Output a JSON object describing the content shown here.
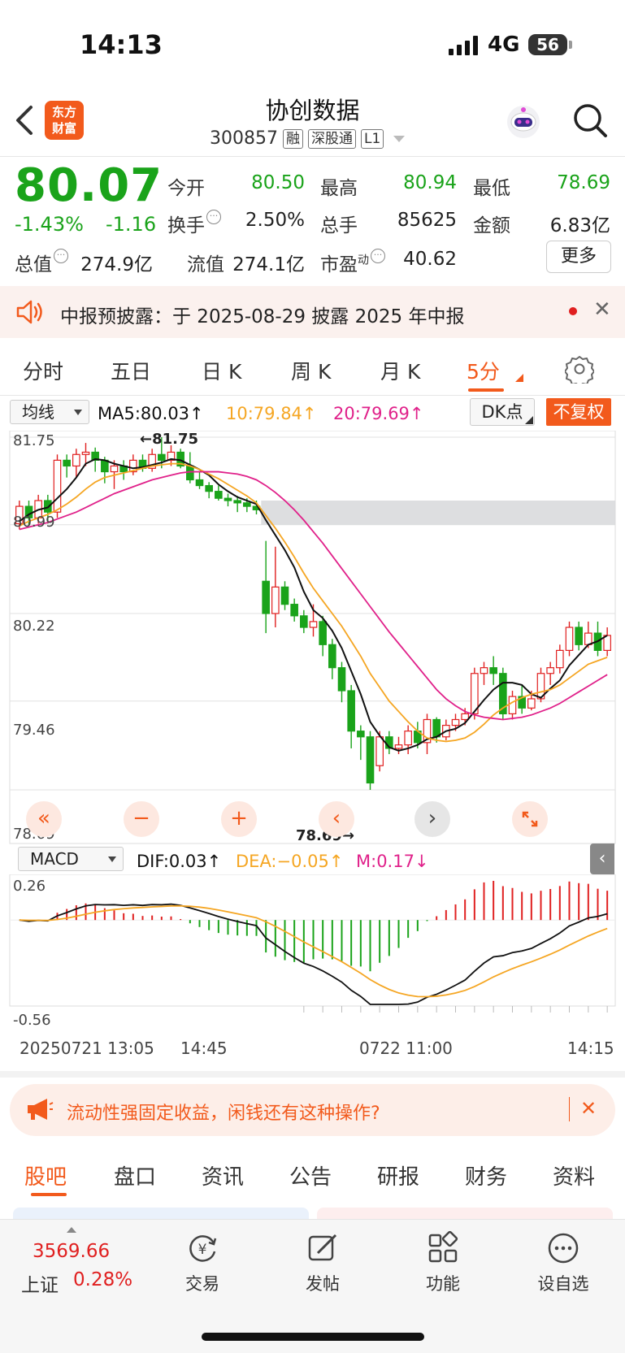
{
  "status": {
    "time": "14:13",
    "network": "4G",
    "battery": "56"
  },
  "header": {
    "logo_line1": "东方",
    "logo_line2": "财富",
    "title": "协创数据",
    "code": "300857",
    "tags": [
      "融",
      "深股通",
      "L1"
    ]
  },
  "quote": {
    "price": "80.07",
    "change_pct": "-1.43%",
    "change": "-1.16",
    "fields": {
      "open_label": "今开",
      "open": "80.50",
      "high_label": "最高",
      "high": "80.94",
      "low_label": "最低",
      "low": "78.69",
      "turnover_label": "换手",
      "turnover": "2.50%",
      "volume_label": "总手",
      "volume": "85625",
      "amount_label": "金额",
      "amount": "6.83亿",
      "mktcap_label": "总值",
      "mktcap": "274.9亿",
      "float_label": "流值",
      "float": "274.1亿",
      "pe_label": "市盈",
      "pe_sup": "动",
      "pe": "40.62"
    },
    "more_label": "更多"
  },
  "notice": {
    "text": "中报预披露：于 2025-08-29 披露 2025 年中报"
  },
  "period_tabs": [
    "分时",
    "五日",
    "日 K",
    "周 K",
    "月 K",
    "5分"
  ],
  "active_period": "5分",
  "indicator_row": {
    "main_select": "均线",
    "ma5": "MA5:80.03↑",
    "ma10": "10:79.84↑",
    "ma20": "20:79.69↑",
    "dk_label": "DK点",
    "fq_label": "不复权"
  },
  "colors": {
    "accent": "#f25a1c",
    "up": "#e02020",
    "down": "#1aa31a",
    "ma5": "#111111",
    "ma10": "#f5a623",
    "ma20": "#e0218a"
  },
  "price_axis": [
    "81.75",
    "80.99",
    "80.22",
    "79.46",
    "78.69"
  ],
  "markers": {
    "high": "←81.75",
    "low": "78.69→"
  },
  "macd": {
    "select": "MACD",
    "dif": "DIF:0.03↑",
    "dea": "DEA:−0.05↑",
    "m": "M:0.17↓",
    "axis_top": "0.26",
    "axis_bottom": "-0.56"
  },
  "time_axis": [
    "20250721 13:05",
    "14:45",
    "0722 11:00",
    "14:15"
  ],
  "chart_data": {
    "type": "candlestick",
    "interval": "5min",
    "ylim": [
      78.69,
      81.75
    ],
    "y_ticks": [
      81.75,
      80.99,
      80.22,
      79.46,
      78.69
    ],
    "high": 81.75,
    "low": 78.69,
    "candles": [
      [
        81.0,
        81.15,
        80.95,
        81.2
      ],
      [
        81.15,
        81.05,
        80.98,
        81.2
      ],
      [
        81.05,
        81.2,
        81.0,
        81.25
      ],
      [
        81.2,
        81.1,
        81.0,
        81.25
      ],
      [
        81.1,
        81.55,
        81.05,
        81.6
      ],
      [
        81.55,
        81.5,
        81.4,
        81.6
      ],
      [
        81.5,
        81.6,
        81.4,
        81.65
      ],
      [
        81.6,
        81.62,
        81.5,
        81.7
      ],
      [
        81.62,
        81.55,
        81.45,
        81.66
      ],
      [
        81.55,
        81.45,
        81.35,
        81.58
      ],
      [
        81.45,
        81.5,
        81.3,
        81.55
      ],
      [
        81.5,
        81.45,
        81.38,
        81.55
      ],
      [
        81.45,
        81.55,
        81.42,
        81.6
      ],
      [
        81.55,
        81.48,
        81.45,
        81.6
      ],
      [
        81.48,
        81.6,
        81.45,
        81.65
      ],
      [
        81.6,
        81.55,
        81.48,
        81.75
      ],
      [
        81.55,
        81.62,
        81.5,
        81.68
      ],
      [
        81.62,
        81.5,
        81.48,
        81.65
      ],
      [
        81.5,
        81.38,
        81.35,
        81.62
      ],
      [
        81.38,
        81.33,
        81.3,
        81.45
      ],
      [
        81.33,
        81.28,
        81.22,
        81.36
      ],
      [
        81.28,
        81.22,
        81.2,
        81.33
      ],
      [
        81.22,
        81.2,
        81.15,
        81.26
      ],
      [
        81.2,
        81.18,
        81.1,
        81.24
      ],
      [
        81.18,
        81.15,
        81.1,
        81.22
      ],
      [
        81.15,
        81.12,
        81.08,
        81.2
      ],
      [
        80.5,
        80.22,
        80.05,
        80.85
      ],
      [
        80.22,
        80.45,
        80.1,
        80.8
      ],
      [
        80.45,
        80.3,
        80.25,
        80.5
      ],
      [
        80.3,
        80.2,
        80.15,
        80.35
      ],
      [
        80.2,
        80.1,
        80.05,
        80.25
      ],
      [
        80.1,
        80.15,
        80.02,
        80.3
      ],
      [
        80.15,
        79.95,
        79.85,
        80.2
      ],
      [
        79.95,
        79.75,
        79.65,
        80.0
      ],
      [
        79.75,
        79.55,
        79.45,
        79.8
      ],
      [
        79.55,
        79.2,
        79.05,
        79.6
      ],
      [
        79.2,
        79.15,
        78.95,
        79.25
      ],
      [
        79.15,
        78.75,
        78.69,
        79.2
      ],
      [
        78.9,
        79.15,
        78.85,
        79.2
      ],
      [
        79.15,
        79.05,
        79.0,
        79.2
      ],
      [
        79.05,
        79.08,
        79.0,
        79.15
      ],
      [
        79.08,
        79.2,
        79.0,
        79.25
      ],
      [
        79.2,
        79.1,
        79.05,
        79.28
      ],
      [
        79.1,
        79.3,
        79.0,
        79.35
      ],
      [
        79.3,
        79.15,
        79.1,
        79.32
      ],
      [
        79.15,
        79.25,
        79.12,
        79.3
      ],
      [
        79.25,
        79.3,
        79.2,
        79.35
      ],
      [
        79.3,
        79.35,
        79.25,
        79.4
      ],
      [
        79.35,
        79.7,
        79.3,
        79.75
      ],
      [
        79.7,
        79.75,
        79.6,
        79.8
      ],
      [
        79.75,
        79.7,
        79.6,
        79.85
      ],
      [
        79.7,
        79.35,
        79.3,
        79.75
      ],
      [
        79.35,
        79.5,
        79.3,
        79.55
      ],
      [
        79.5,
        79.4,
        79.35,
        79.6
      ],
      [
        79.4,
        79.48,
        79.38,
        79.55
      ],
      [
        79.48,
        79.7,
        79.45,
        79.75
      ],
      [
        79.7,
        79.75,
        79.6,
        79.8
      ],
      [
        79.75,
        79.9,
        79.7,
        79.95
      ],
      [
        79.9,
        80.1,
        79.85,
        80.15
      ],
      [
        80.1,
        79.95,
        79.9,
        80.15
      ],
      [
        79.95,
        80.05,
        79.92,
        80.15
      ],
      [
        80.05,
        79.9,
        79.85,
        80.15
      ],
      [
        79.9,
        80.03,
        79.85,
        80.1
      ]
    ],
    "series": [
      {
        "name": "MA5",
        "values": [
          81.02,
          81.08,
          81.12,
          81.14,
          81.22,
          81.3,
          81.4,
          81.52,
          81.56,
          81.55,
          81.52,
          81.5,
          81.48,
          81.49,
          81.51,
          81.53,
          81.56,
          81.55,
          81.51,
          81.47,
          81.42,
          81.34,
          81.28,
          81.23,
          81.2,
          81.17,
          81.03,
          80.9,
          80.77,
          80.62,
          80.41,
          80.25,
          80.18,
          80.07,
          79.92,
          79.72,
          79.52,
          79.28,
          79.16,
          79.06,
          79.03,
          79.05,
          79.08,
          79.13,
          79.15,
          79.2,
          79.22,
          79.27,
          79.37,
          79.47,
          79.56,
          79.62,
          79.62,
          79.6,
          79.52,
          79.49,
          79.57,
          79.64,
          79.77,
          79.86,
          79.95,
          79.98,
          80.03
        ]
      },
      {
        "name": "10",
        "values": [
          80.98,
          81.02,
          81.05,
          81.08,
          81.12,
          81.17,
          81.23,
          81.3,
          81.36,
          81.4,
          81.42,
          81.44,
          81.46,
          81.48,
          81.5,
          81.51,
          81.52,
          81.52,
          81.5,
          81.47,
          81.43,
          81.39,
          81.34,
          81.29,
          81.24,
          81.18,
          81.07,
          80.96,
          80.84,
          80.71,
          80.57,
          80.44,
          80.33,
          80.22,
          80.11,
          79.98,
          79.85,
          79.7,
          79.58,
          79.46,
          79.37,
          79.28,
          79.2,
          79.14,
          79.12,
          79.11,
          79.12,
          79.14,
          79.19,
          79.26,
          79.34,
          79.4,
          79.45,
          79.49,
          79.52,
          79.54,
          79.56,
          79.6,
          79.66,
          79.72,
          79.78,
          79.81,
          79.84
        ]
      },
      {
        "name": "20",
        "values": [
          80.95,
          80.97,
          80.99,
          81.01,
          81.04,
          81.07,
          81.1,
          81.14,
          81.18,
          81.22,
          81.26,
          81.29,
          81.32,
          81.35,
          81.38,
          81.4,
          81.42,
          81.44,
          81.45,
          81.45,
          81.45,
          81.45,
          81.44,
          81.43,
          81.41,
          81.38,
          81.33,
          81.27,
          81.2,
          81.12,
          81.03,
          80.93,
          80.83,
          80.72,
          80.61,
          80.5,
          80.39,
          80.28,
          80.17,
          80.06,
          79.96,
          79.86,
          79.76,
          79.66,
          79.56,
          79.48,
          79.42,
          79.37,
          79.34,
          79.32,
          79.31,
          79.3,
          79.31,
          79.32,
          79.34,
          79.37,
          79.4,
          79.44,
          79.49,
          79.54,
          79.59,
          79.64,
          79.69
        ]
      }
    ],
    "resistance_band": [
      80.99,
      81.2
    ],
    "macd_ylim": [
      -0.56,
      0.26
    ]
  },
  "promo": {
    "text": "流动性强固定收益，闲钱还有这种操作?"
  },
  "bottom_tabs": [
    "股吧",
    "盘口",
    "资讯",
    "公告",
    "研报",
    "财务",
    "资料"
  ],
  "bottom_nav": {
    "index_value": "3569.66",
    "index_name": "上证",
    "index_pct": "0.28%",
    "items": [
      "交易",
      "发帖",
      "功能",
      "设自选"
    ]
  }
}
